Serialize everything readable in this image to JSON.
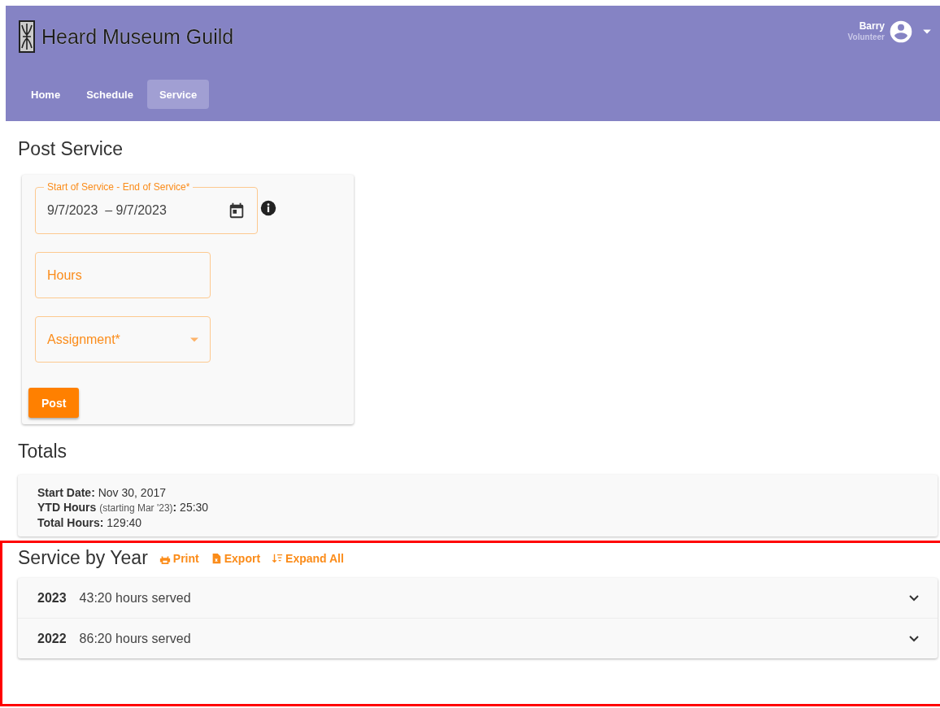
{
  "header": {
    "brand": "Heard Museum Guild",
    "user": {
      "name": "Barry",
      "role": "Volunteer"
    },
    "tabs": [
      {
        "label": "Home",
        "selected": false
      },
      {
        "label": "Schedule",
        "selected": false
      },
      {
        "label": "Service",
        "selected": true
      }
    ]
  },
  "post_service": {
    "title": "Post Service",
    "date_range": {
      "label": "Start of Service - End of Service*",
      "start": "9/7/2023",
      "separator": "–",
      "end": "9/7/2023"
    },
    "hours": {
      "placeholder": "Hours"
    },
    "assignment": {
      "placeholder": "Assignment*"
    },
    "button": "Post"
  },
  "totals": {
    "title": "Totals",
    "lines": [
      {
        "label": "Start Date",
        "separator": ":",
        "value": "Nov 30, 2017"
      },
      {
        "label": "YTD Hours",
        "note": "(starting Mar '23)",
        "separator": ":",
        "value": "25:30"
      },
      {
        "label": "Total Hours",
        "separator": ":",
        "value": "129:40"
      }
    ]
  },
  "service_by_year": {
    "title": "Service by Year",
    "highlighted": true,
    "actions": [
      {
        "kind": "print",
        "label": "Print"
      },
      {
        "kind": "export",
        "label": "Export"
      },
      {
        "kind": "expand",
        "label": "Expand All"
      }
    ],
    "years": [
      {
        "year": "2023",
        "summary": "43:20 hours served",
        "expanded": false
      },
      {
        "year": "2022",
        "summary": "86:20 hours served",
        "expanded": false
      }
    ]
  }
}
